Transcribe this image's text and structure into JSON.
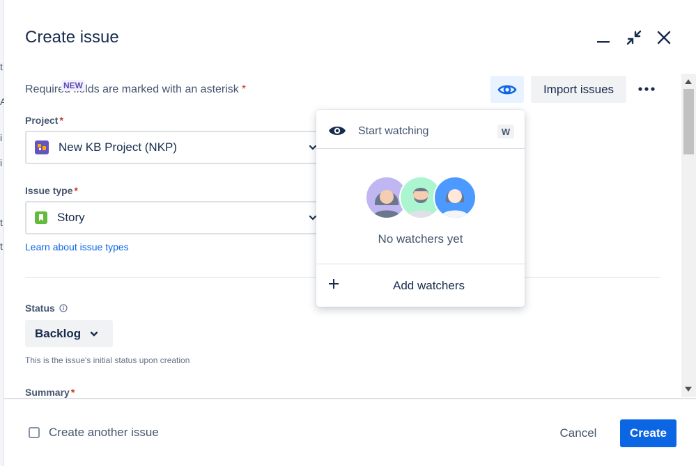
{
  "background": {
    "chars": [
      "t",
      "A",
      "i",
      "t",
      "t",
      "i"
    ]
  },
  "modal": {
    "title": "Create issue",
    "new_badge": "NEW",
    "required_text": "Required fields are marked with an asterisk",
    "asterisk": "*",
    "import_button": "Import issues"
  },
  "fields": {
    "project": {
      "label": "Project",
      "value": "New KB Project (NKP)"
    },
    "issue_type": {
      "label": "Issue type",
      "value": "Story"
    },
    "learn_link": "Learn about issue types",
    "status": {
      "label": "Status",
      "value": "Backlog",
      "helper": "This is the issue's initial status upon creation"
    },
    "summary": {
      "label": "Summary"
    }
  },
  "watch_popup": {
    "start_watching": "Start watching",
    "shortcut": "W",
    "empty_text": "No watchers yet",
    "add_watchers": "Add watchers"
  },
  "footer": {
    "checkbox_label": "Create another issue",
    "cancel": "Cancel",
    "create": "Create"
  },
  "colors": {
    "primary": "#0C66E4",
    "text": "#172B4D",
    "subtle_text": "#44546F",
    "required": "#C9372C",
    "new_badge": "#5E4DB2"
  },
  "icons": [
    "minimize-icon",
    "shrink-icon",
    "close-icon",
    "eye-icon",
    "more-icon",
    "project-avatar-icon",
    "story-icon",
    "chevron-down-icon",
    "info-icon",
    "plus-icon"
  ]
}
